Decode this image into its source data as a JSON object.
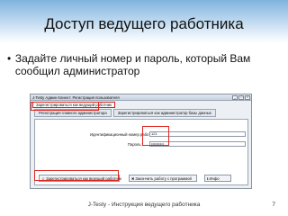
{
  "slide": {
    "title": "Доступ ведущего работника",
    "bullet": "Задайте личный номер и пароль, который Вам сообщил администратор",
    "footer": "J-Testy - Инструкция ведущего работника",
    "page_number": "7"
  },
  "window": {
    "title": "J-Testy Админ Клиент: Регистрация пользователя",
    "menu_item": "Зарегистрироваться как ведущий работник",
    "tabs": [
      "Регистрация главного администратора",
      "Зарегистрироваться как администратор базы данных"
    ],
    "id_label": "Идентификационный номер работника:",
    "id_value": "121",
    "password_label": "Пароль:",
    "password_value": "••••••••••",
    "buttons": {
      "register": "Зарегистрироваться как ведущий работник",
      "close": "Закончить работу с программой",
      "info": "Инфо"
    }
  },
  "colors": {
    "highlight": "#e0241d",
    "header_gradient": "#7fb3de"
  }
}
